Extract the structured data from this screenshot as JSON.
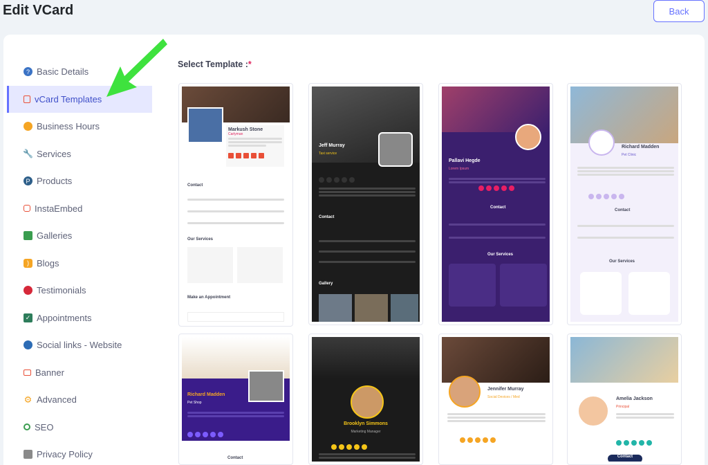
{
  "page": {
    "title": "Edit VCard",
    "back_label": "Back"
  },
  "sidebar": {
    "items": [
      {
        "label": "Basic Details",
        "icon": "info-icon",
        "color": "#3b73c5"
      },
      {
        "label": "vCard Templates",
        "icon": "template-icon",
        "color": "#e94f37",
        "active": true
      },
      {
        "label": "Business Hours",
        "icon": "clock-icon",
        "color": "#f5a524"
      },
      {
        "label": "Services",
        "icon": "wrench-icon",
        "color": "#d08a3f"
      },
      {
        "label": "Products",
        "icon": "product-icon",
        "color": "#2e5f8a"
      },
      {
        "label": "InstaEmbed",
        "icon": "instagram-icon",
        "color": "#e94f37"
      },
      {
        "label": "Galleries",
        "icon": "gallery-icon",
        "color": "#3a9d4f"
      },
      {
        "label": "Blogs",
        "icon": "rss-icon",
        "color": "#f5a524"
      },
      {
        "label": "Testimonials",
        "icon": "chat-icon",
        "color": "#d62839"
      },
      {
        "label": "Appointments",
        "icon": "calendar-icon",
        "color": "#2e7d5b"
      },
      {
        "label": "Social links - Website",
        "icon": "globe-icon",
        "color": "#2d6cb5"
      },
      {
        "label": "Banner",
        "icon": "banner-icon",
        "color": "#e94f37"
      },
      {
        "label": "Advanced",
        "icon": "gears-icon",
        "color": "#f5a524"
      },
      {
        "label": "SEO",
        "icon": "search-icon",
        "color": "#3a9d4f"
      },
      {
        "label": "Privacy Policy",
        "icon": "lock-icon",
        "color": "#8a8a8a"
      }
    ]
  },
  "templates": {
    "label": "Select Template :",
    "required_mark": "*",
    "items": [
      {
        "name": "Markush Stone",
        "role": "Carlyman",
        "s1": "Contact",
        "s2": "Our Services",
        "s3": "Make an Appointment",
        "theme": "light"
      },
      {
        "name": "Jeff Murray",
        "role": "Taxi service",
        "s1": "Contact",
        "s2": "Gallery",
        "theme": "dark"
      },
      {
        "name": "Pallavi Hegde",
        "role": "Lorem Ipsum",
        "s1": "Contact",
        "s2": "Our Services",
        "theme": "purple"
      },
      {
        "name": "Richard Madden",
        "role": "Pet Clinic",
        "s1": "Contact",
        "s2": "Our Services",
        "theme": "lavender"
      },
      {
        "name": "Richard Madden",
        "role": "Pet Shop",
        "s1": "Contact",
        "theme": "indigo"
      },
      {
        "name": "Brooklyn Simmons",
        "role": "Marketing Manager",
        "theme": "black"
      },
      {
        "name": "Jennifer Murray",
        "role": "Social Devices / Med",
        "theme": "orange"
      },
      {
        "name": "Amelia Jackson",
        "role": "Principal",
        "s1": "Contact",
        "theme": "kids"
      }
    ]
  },
  "colors": {
    "accent": "#6571ff",
    "arrow": "#3ee23e"
  }
}
